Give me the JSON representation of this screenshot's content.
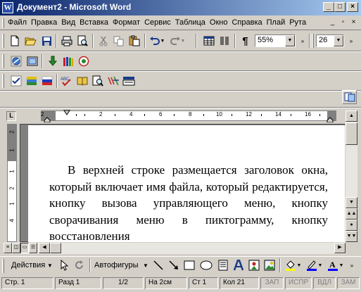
{
  "window": {
    "title": "Документ2 - Microsoft Word",
    "app_icon": "W"
  },
  "menu": {
    "items": [
      "Файл",
      "Правка",
      "Вид",
      "Вставка",
      "Формат",
      "Сервис",
      "Таблица",
      "Окно",
      "Справка",
      "Плай",
      "Рута"
    ]
  },
  "toolbar_standard": {
    "zoom": "55%",
    "font_size": "26"
  },
  "ruler": {
    "h_numbers": [
      "2",
      "2",
      "4",
      "6",
      "8",
      "10",
      "12",
      "14",
      "16"
    ],
    "v_numbers": [
      "2",
      "1",
      "1",
      "2",
      "1",
      "4"
    ],
    "tab_selector": "L"
  },
  "document": {
    "paragraph": "В верхней строке размещается заголовок окна, который включает имя файла, который редактируется, кнопку вызова управляющего меню, кнопку сворачивания меню в пиктограмму, кнопку восстановления"
  },
  "drawing_toolbar": {
    "actions_label": "Действия",
    "autoshapes_label": "Автофигуры"
  },
  "status": {
    "page": "Стр. 1",
    "section": "Разд 1",
    "page_of": "1/2",
    "at": "На 2см",
    "line": "Ст 1",
    "col": "Кол 21",
    "rec": "ЗАП",
    "trk": "ИСПР",
    "ext": "ВДЛ",
    "ovr": "ЗАМ"
  },
  "colors": {
    "title_start": "#0a246a",
    "title_end": "#a6caf0",
    "face": "#d4d0c8",
    "highlight": "#ffff00",
    "font_color": "#0000ff",
    "line_color": "#0000ff"
  }
}
